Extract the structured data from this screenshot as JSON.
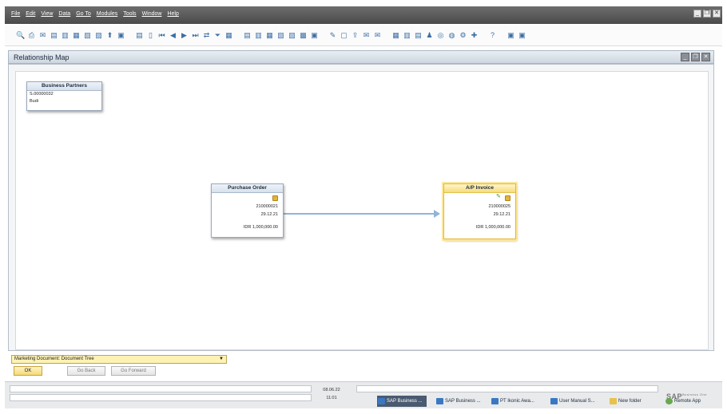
{
  "menu": [
    "File",
    "Edit",
    "View",
    "Data",
    "Go To",
    "Modules",
    "Tools",
    "Window",
    "Help"
  ],
  "window": {
    "title": "Relationship Map"
  },
  "nodes": {
    "business_partner": {
      "title": "Business Partners",
      "code": "S.00000032",
      "name": "Budi"
    },
    "purchase_order": {
      "title": "Purchase Order",
      "number": "210000021",
      "date": "29.12.21",
      "amount": "IDR 1,000,000.00"
    },
    "ap_invoice": {
      "title": "A/P Invoice",
      "number": "210000025",
      "date": "29.12.21",
      "amount": "IDR 1,000,000.00"
    }
  },
  "tree_selector": {
    "value": "Marketing Document: Document Tree"
  },
  "buttons": {
    "ok": "OK",
    "go_back": "Go Back",
    "go_forward": "Go Forward"
  },
  "status": {
    "date": "08.06.22",
    "time": "11:01"
  },
  "taskbar": [
    "SAP Business ...",
    "SAP Business ...",
    "PT Ikonic Awa...",
    "User Manual S...",
    "New folder",
    "Remote App"
  ],
  "brand": {
    "logo": "SAP",
    "sub": "Business One"
  },
  "colors": {
    "accent": "#e3b631",
    "connector": "#8fb5d8"
  }
}
